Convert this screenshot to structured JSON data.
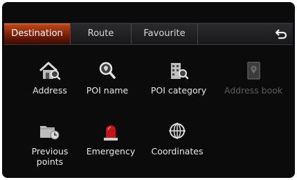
{
  "tabs": [
    {
      "label": "Destination",
      "active": true
    },
    {
      "label": "Route",
      "active": false
    },
    {
      "label": "Favourite",
      "active": false
    }
  ],
  "back_icon": "back-arrow-icon",
  "menu": [
    {
      "label": "Address",
      "icon": "house-search-icon",
      "enabled": true
    },
    {
      "label": "POI name",
      "icon": "magnifier-icon",
      "enabled": true
    },
    {
      "label": "POI category",
      "icon": "building-search-icon",
      "enabled": true
    },
    {
      "label": "Address book",
      "icon": "address-book-icon",
      "enabled": false
    },
    {
      "label": "Previous\npoints",
      "icon": "folder-clock-icon",
      "enabled": true
    },
    {
      "label": "Emergency",
      "icon": "siren-icon",
      "enabled": true
    },
    {
      "label": "Coordinates",
      "icon": "crosshair-globe-icon",
      "enabled": true
    }
  ],
  "colors": {
    "active_tab": "#a8380e",
    "background": "#0b0b0c",
    "text": "#e8e8e8",
    "disabled_text": "#5e5e5e"
  }
}
